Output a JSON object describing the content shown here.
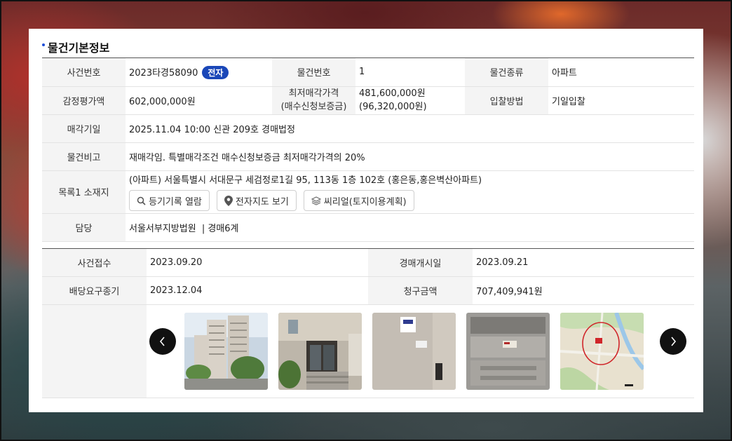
{
  "section_title": "물건기본정보",
  "basic": {
    "case_no_label": "사건번호",
    "case_no": "2023타경58090",
    "badge": "전자",
    "item_no_label": "물건번호",
    "item_no": "1",
    "item_type_label": "물건종류",
    "item_type": "아파트",
    "appraisal_label": "감정평가액",
    "appraisal": "602,000,000원",
    "min_price_label_1": "최저매각가격",
    "min_price_label_2": "(매수신청보증금)",
    "min_price": "481,600,000원",
    "deposit": "(96,320,000원)",
    "bid_method_label": "입찰방법",
    "bid_method": "기일입찰",
    "sale_date_label": "매각기일",
    "sale_date": "2025.11.04 10:00 신관 209호 경매법정",
    "remarks_label": "물건비고",
    "remarks": "재매각임. 특별매각조건 매수신청보증금 최저매각가격의 20%",
    "location_label": "목록1 소재지",
    "location": "(아파트) 서울특별시 서대문구 세검정로1길 95, 113동 1층 102호 (홍은동,홍은벽산아파트)",
    "btn_registry": "등기기록 열람",
    "btn_map": "전자지도 보기",
    "btn_seereal": "씨리얼(토지이용계획)",
    "manager_label": "담당",
    "manager": "서울서부지방법원",
    "manager_dept": "| 경매6계"
  },
  "case": {
    "received_label": "사건접수",
    "received": "2023.09.20",
    "start_label": "경매개시일",
    "start": "2023.09.21",
    "dividend_label": "배당요구종기",
    "dividend": "2023.12.04",
    "claim_label": "청구금액",
    "claim": "707,409,941원"
  },
  "icons": {
    "search": "search-icon",
    "map_pin": "map-pin-icon",
    "layers": "layers-icon",
    "prev": "chevron-left-icon",
    "next": "chevron-right-icon"
  },
  "colors": {
    "badge": "#1a47b8",
    "title_dot": "#1e4ed8",
    "label_bg": "#f4f4f4"
  }
}
